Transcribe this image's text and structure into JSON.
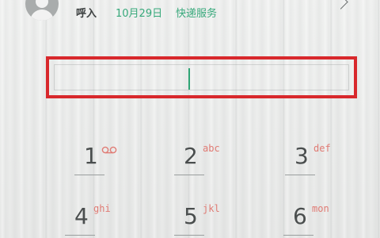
{
  "call_log": {
    "type": "呼入",
    "date": "10月29日",
    "name": "快递服务"
  },
  "display": {
    "value": ""
  },
  "keypad": {
    "keys": [
      {
        "digit": "1",
        "letters": "",
        "icon": "voicemail-icon"
      },
      {
        "digit": "2",
        "letters": "abc"
      },
      {
        "digit": "3",
        "letters": "def"
      },
      {
        "digit": "4",
        "letters": "ghi"
      },
      {
        "digit": "5",
        "letters": "jkl"
      },
      {
        "digit": "6",
        "letters": "mon"
      }
    ]
  },
  "colors": {
    "accent": "#36a87a",
    "highlight": "#d8282c",
    "letters": "#e07b74"
  }
}
